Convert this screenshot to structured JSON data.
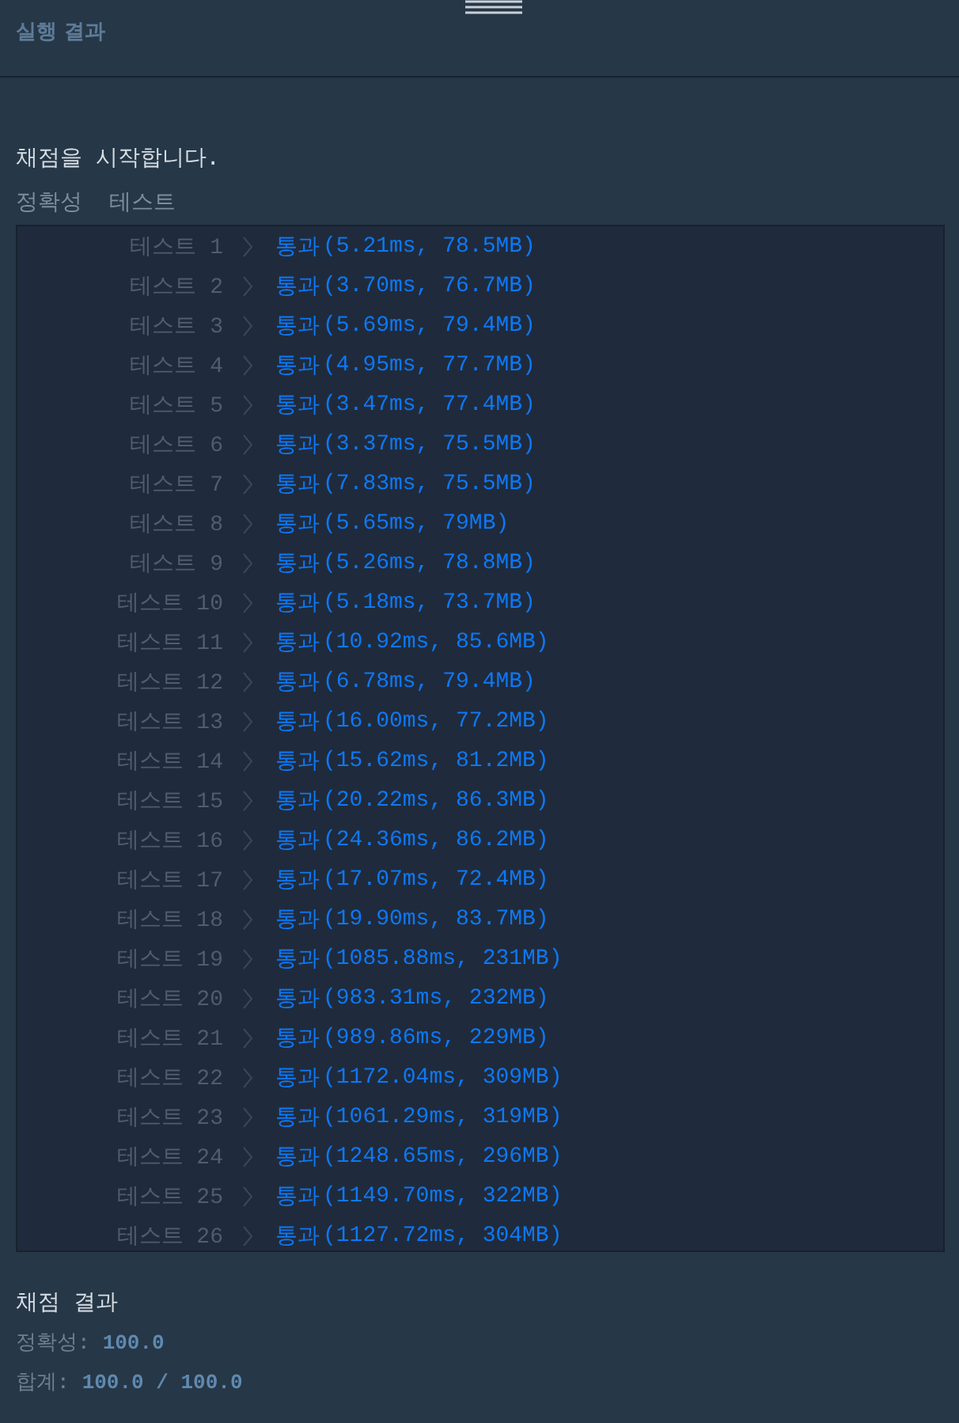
{
  "panel": {
    "title": "실행 결과"
  },
  "start_message": "채점을 시작합니다.",
  "section_label": "정확성  테스트",
  "tests": [
    {
      "label": "테스트 1",
      "status": "통과",
      "passed": true,
      "result": "(5.21ms, 78.5MB)"
    },
    {
      "label": "테스트 2",
      "status": "통과",
      "passed": true,
      "result": "(3.70ms, 76.7MB)"
    },
    {
      "label": "테스트 3",
      "status": "통과",
      "passed": true,
      "result": "(5.69ms, 79.4MB)"
    },
    {
      "label": "테스트 4",
      "status": "통과",
      "passed": true,
      "result": "(4.95ms, 77.7MB)"
    },
    {
      "label": "테스트 5",
      "status": "통과",
      "passed": true,
      "result": "(3.47ms, 77.4MB)"
    },
    {
      "label": "테스트 6",
      "status": "통과",
      "passed": true,
      "result": "(3.37ms, 75.5MB)"
    },
    {
      "label": "테스트 7",
      "status": "통과",
      "passed": true,
      "result": "(7.83ms, 75.5MB)"
    },
    {
      "label": "테스트 8",
      "status": "통과",
      "passed": true,
      "result": "(5.65ms, 79MB)"
    },
    {
      "label": "테스트 9",
      "status": "통과",
      "passed": true,
      "result": "(5.26ms, 78.8MB)"
    },
    {
      "label": "테스트 10",
      "status": "통과",
      "passed": true,
      "result": "(5.18ms, 73.7MB)"
    },
    {
      "label": "테스트 11",
      "status": "통과",
      "passed": true,
      "result": "(10.92ms, 85.6MB)"
    },
    {
      "label": "테스트 12",
      "status": "통과",
      "passed": true,
      "result": "(6.78ms, 79.4MB)"
    },
    {
      "label": "테스트 13",
      "status": "통과",
      "passed": true,
      "result": "(16.00ms, 77.2MB)"
    },
    {
      "label": "테스트 14",
      "status": "통과",
      "passed": true,
      "result": "(15.62ms, 81.2MB)"
    },
    {
      "label": "테스트 15",
      "status": "통과",
      "passed": true,
      "result": "(20.22ms, 86.3MB)"
    },
    {
      "label": "테스트 16",
      "status": "통과",
      "passed": true,
      "result": "(24.36ms, 86.2MB)"
    },
    {
      "label": "테스트 17",
      "status": "통과",
      "passed": true,
      "result": "(17.07ms, 72.4MB)"
    },
    {
      "label": "테스트 18",
      "status": "통과",
      "passed": true,
      "result": "(19.90ms, 83.7MB)"
    },
    {
      "label": "테스트 19",
      "status": "통과",
      "passed": true,
      "result": "(1085.88ms, 231MB)"
    },
    {
      "label": "테스트 20",
      "status": "통과",
      "passed": true,
      "result": "(983.31ms, 232MB)"
    },
    {
      "label": "테스트 21",
      "status": "통과",
      "passed": true,
      "result": "(989.86ms, 229MB)"
    },
    {
      "label": "테스트 22",
      "status": "통과",
      "passed": true,
      "result": "(1172.04ms, 309MB)"
    },
    {
      "label": "테스트 23",
      "status": "통과",
      "passed": true,
      "result": "(1061.29ms, 319MB)"
    },
    {
      "label": "테스트 24",
      "status": "통과",
      "passed": true,
      "result": "(1248.65ms, 296MB)"
    },
    {
      "label": "테스트 25",
      "status": "통과",
      "passed": true,
      "result": "(1149.70ms, 322MB)"
    },
    {
      "label": "테스트 26",
      "status": "통과",
      "passed": true,
      "result": "(1127.72ms, 304MB)"
    }
  ],
  "summary": {
    "title": "채점 결과",
    "lines": [
      {
        "label": "정확성:",
        "value": "100.0"
      },
      {
        "label": "합계:",
        "value": "100.0 / 100.0"
      }
    ]
  }
}
